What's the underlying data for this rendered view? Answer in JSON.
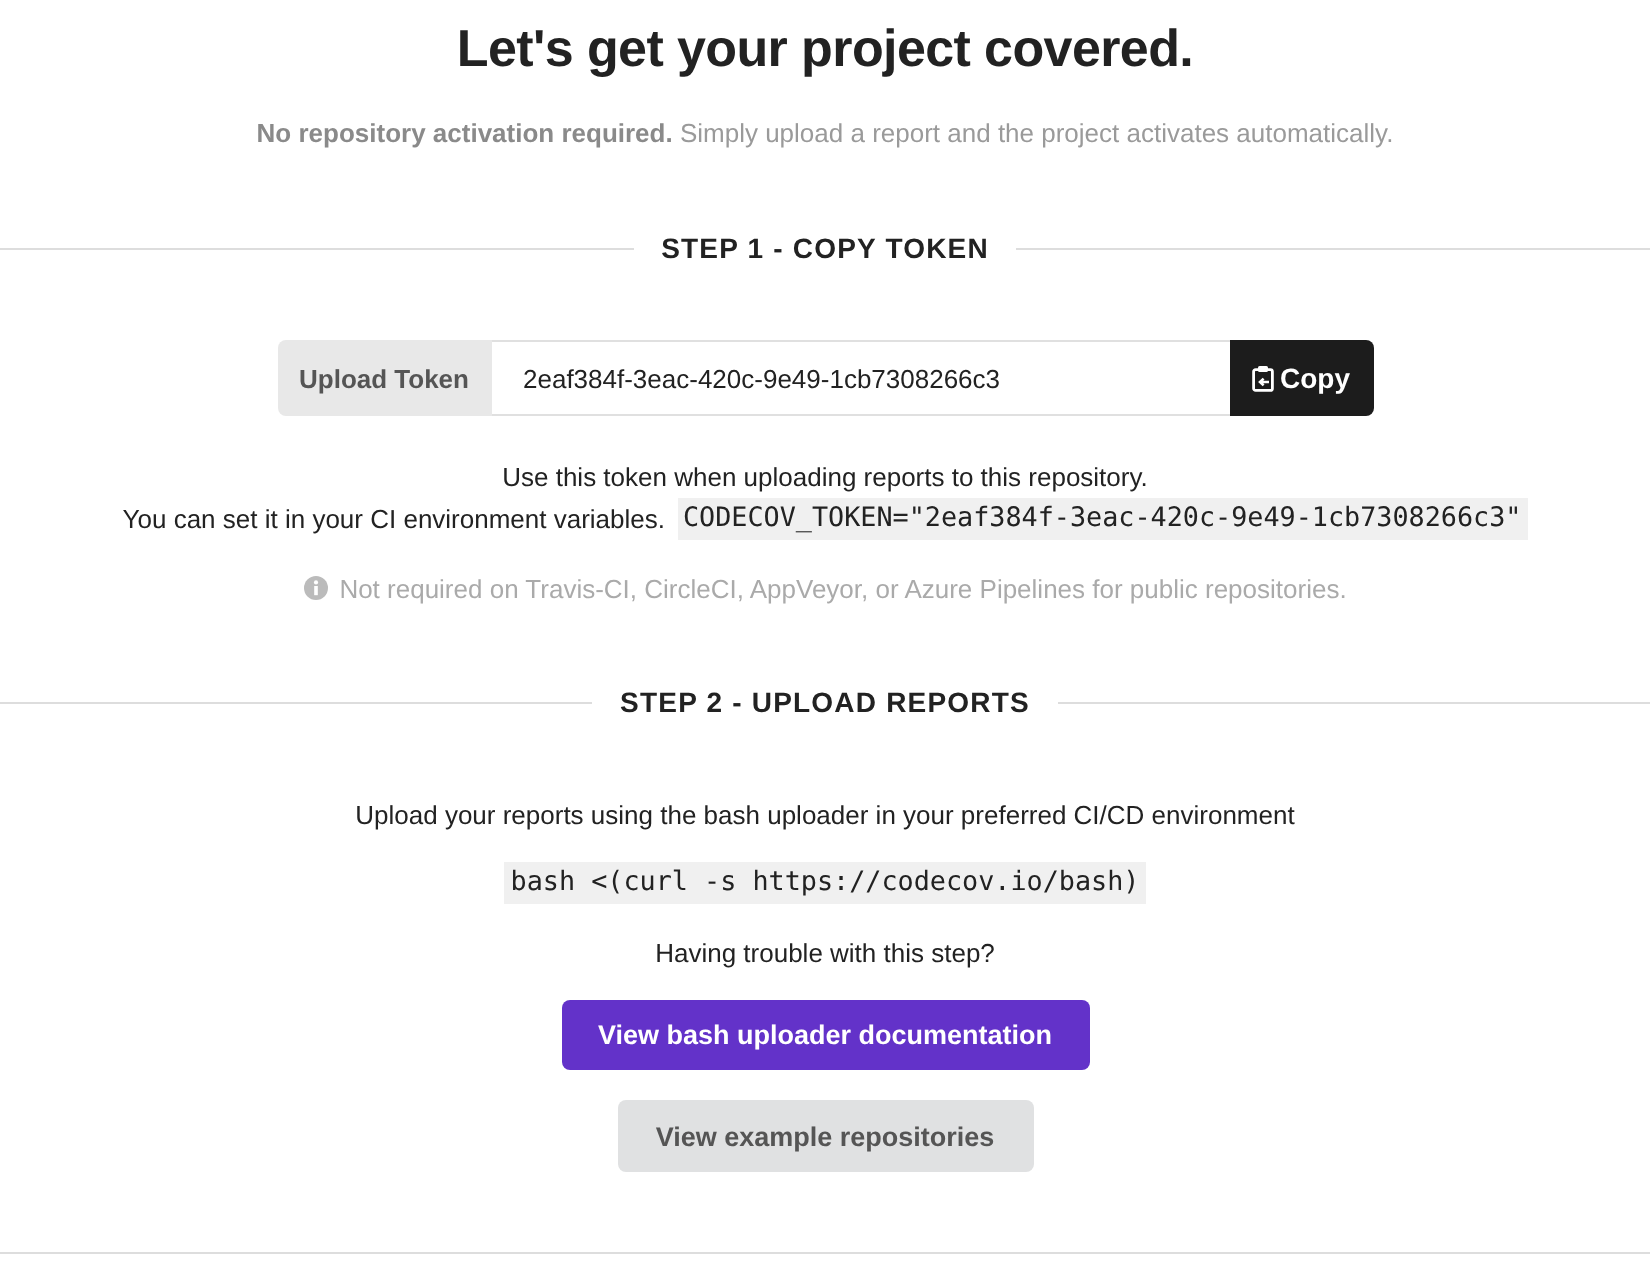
{
  "header": {
    "title": "Let's get your project covered.",
    "subtitle": "**No repository activation required.** Simply upload a report and the project activates automatically."
  },
  "step_1": {
    "heading": "STEP 1 - COPY TOKEN",
    "token_field": {
      "label": "Upload Token",
      "value": "2eaf384f-3eac-420c-9e49-1cb7308266c3",
      "button": "Copy"
    },
    "instructions": "Use this token when uploading reports to this repository.",
    "env_hint": "You can set it in your CI environment variables.",
    "env_code": "CODECOV_TOKEN=\"2eaf384f-3eac-420c-9e49-1cb7308266c3\"",
    "note": "Not required on Travis-CI, CircleCI, AppVeyor, or Azure Pipelines for public repositories."
  },
  "step_2": {
    "heading": "STEP 2 - UPLOAD REPORTS",
    "instructions": "Upload your reports using the bash uploader in your preferred CI/CD environment",
    "command": "bash <(curl -s https://codecov.io/bash)",
    "help_text": "Having trouble with this step?",
    "buttons": [
      {
        "label": "View bash uploader documentation",
        "kind": "primary"
      },
      {
        "label": "View example repositories",
        "kind": "secondary"
      }
    ]
  }
}
